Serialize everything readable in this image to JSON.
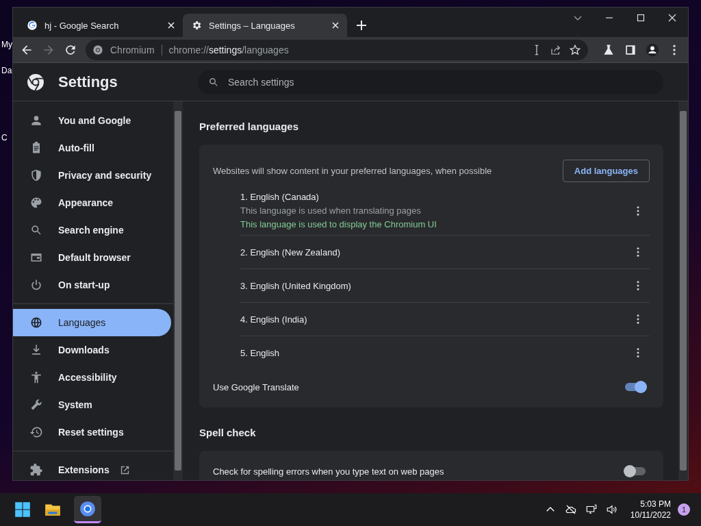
{
  "desktop": {
    "labels": [
      "My",
      "Da",
      "C"
    ]
  },
  "tabs": [
    {
      "title": "hj - Google Search",
      "kind": "google",
      "selected": false
    },
    {
      "title": "Settings – Languages",
      "kind": "settings",
      "selected": true
    }
  ],
  "address_bar": {
    "site": "Chromium",
    "url_prefix": "chrome://",
    "url_host": "settings",
    "url_path": "/languages"
  },
  "settings": {
    "title": "Settings",
    "search_placeholder": "Search settings"
  },
  "sidebar": {
    "groups": [
      [
        {
          "label": "You and Google",
          "selected": false
        },
        {
          "label": "Auto-fill",
          "selected": false
        },
        {
          "label": "Privacy and security",
          "selected": false
        },
        {
          "label": "Appearance",
          "selected": false
        },
        {
          "label": "Search engine",
          "selected": false
        },
        {
          "label": "Default browser",
          "selected": false
        },
        {
          "label": "On start-up",
          "selected": false
        }
      ],
      [
        {
          "label": "Languages",
          "selected": true
        },
        {
          "label": "Downloads",
          "selected": false
        },
        {
          "label": "Accessibility",
          "selected": false
        },
        {
          "label": "System",
          "selected": false
        },
        {
          "label": "Reset settings",
          "selected": false
        }
      ],
      [
        {
          "label": "Extensions",
          "selected": false
        }
      ]
    ]
  },
  "preferred_languages": {
    "title": "Preferred languages",
    "description": "Websites will show content in your preferred languages, when possible",
    "add_button": "Add languages",
    "languages": [
      {
        "name": "1. English (Canada)",
        "notes": [
          {
            "text": "This language is used when translating pages",
            "kind": "info"
          },
          {
            "text": "This language is used to display the Chromium UI",
            "kind": "highlight"
          }
        ]
      },
      {
        "name": "2. English (New Zealand)"
      },
      {
        "name": "3. English (United Kingdom)"
      },
      {
        "name": "4. English (India)"
      },
      {
        "name": "5. English"
      }
    ],
    "translate": {
      "label": "Use Google Translate",
      "on": true
    }
  },
  "spell_check": {
    "title": "Spell check",
    "option": {
      "label": "Check for spelling errors when you type text on web pages",
      "on": false
    }
  },
  "taskbar": {
    "time": "5:03 PM",
    "date": "10/11/2022",
    "notification_count": "1"
  }
}
